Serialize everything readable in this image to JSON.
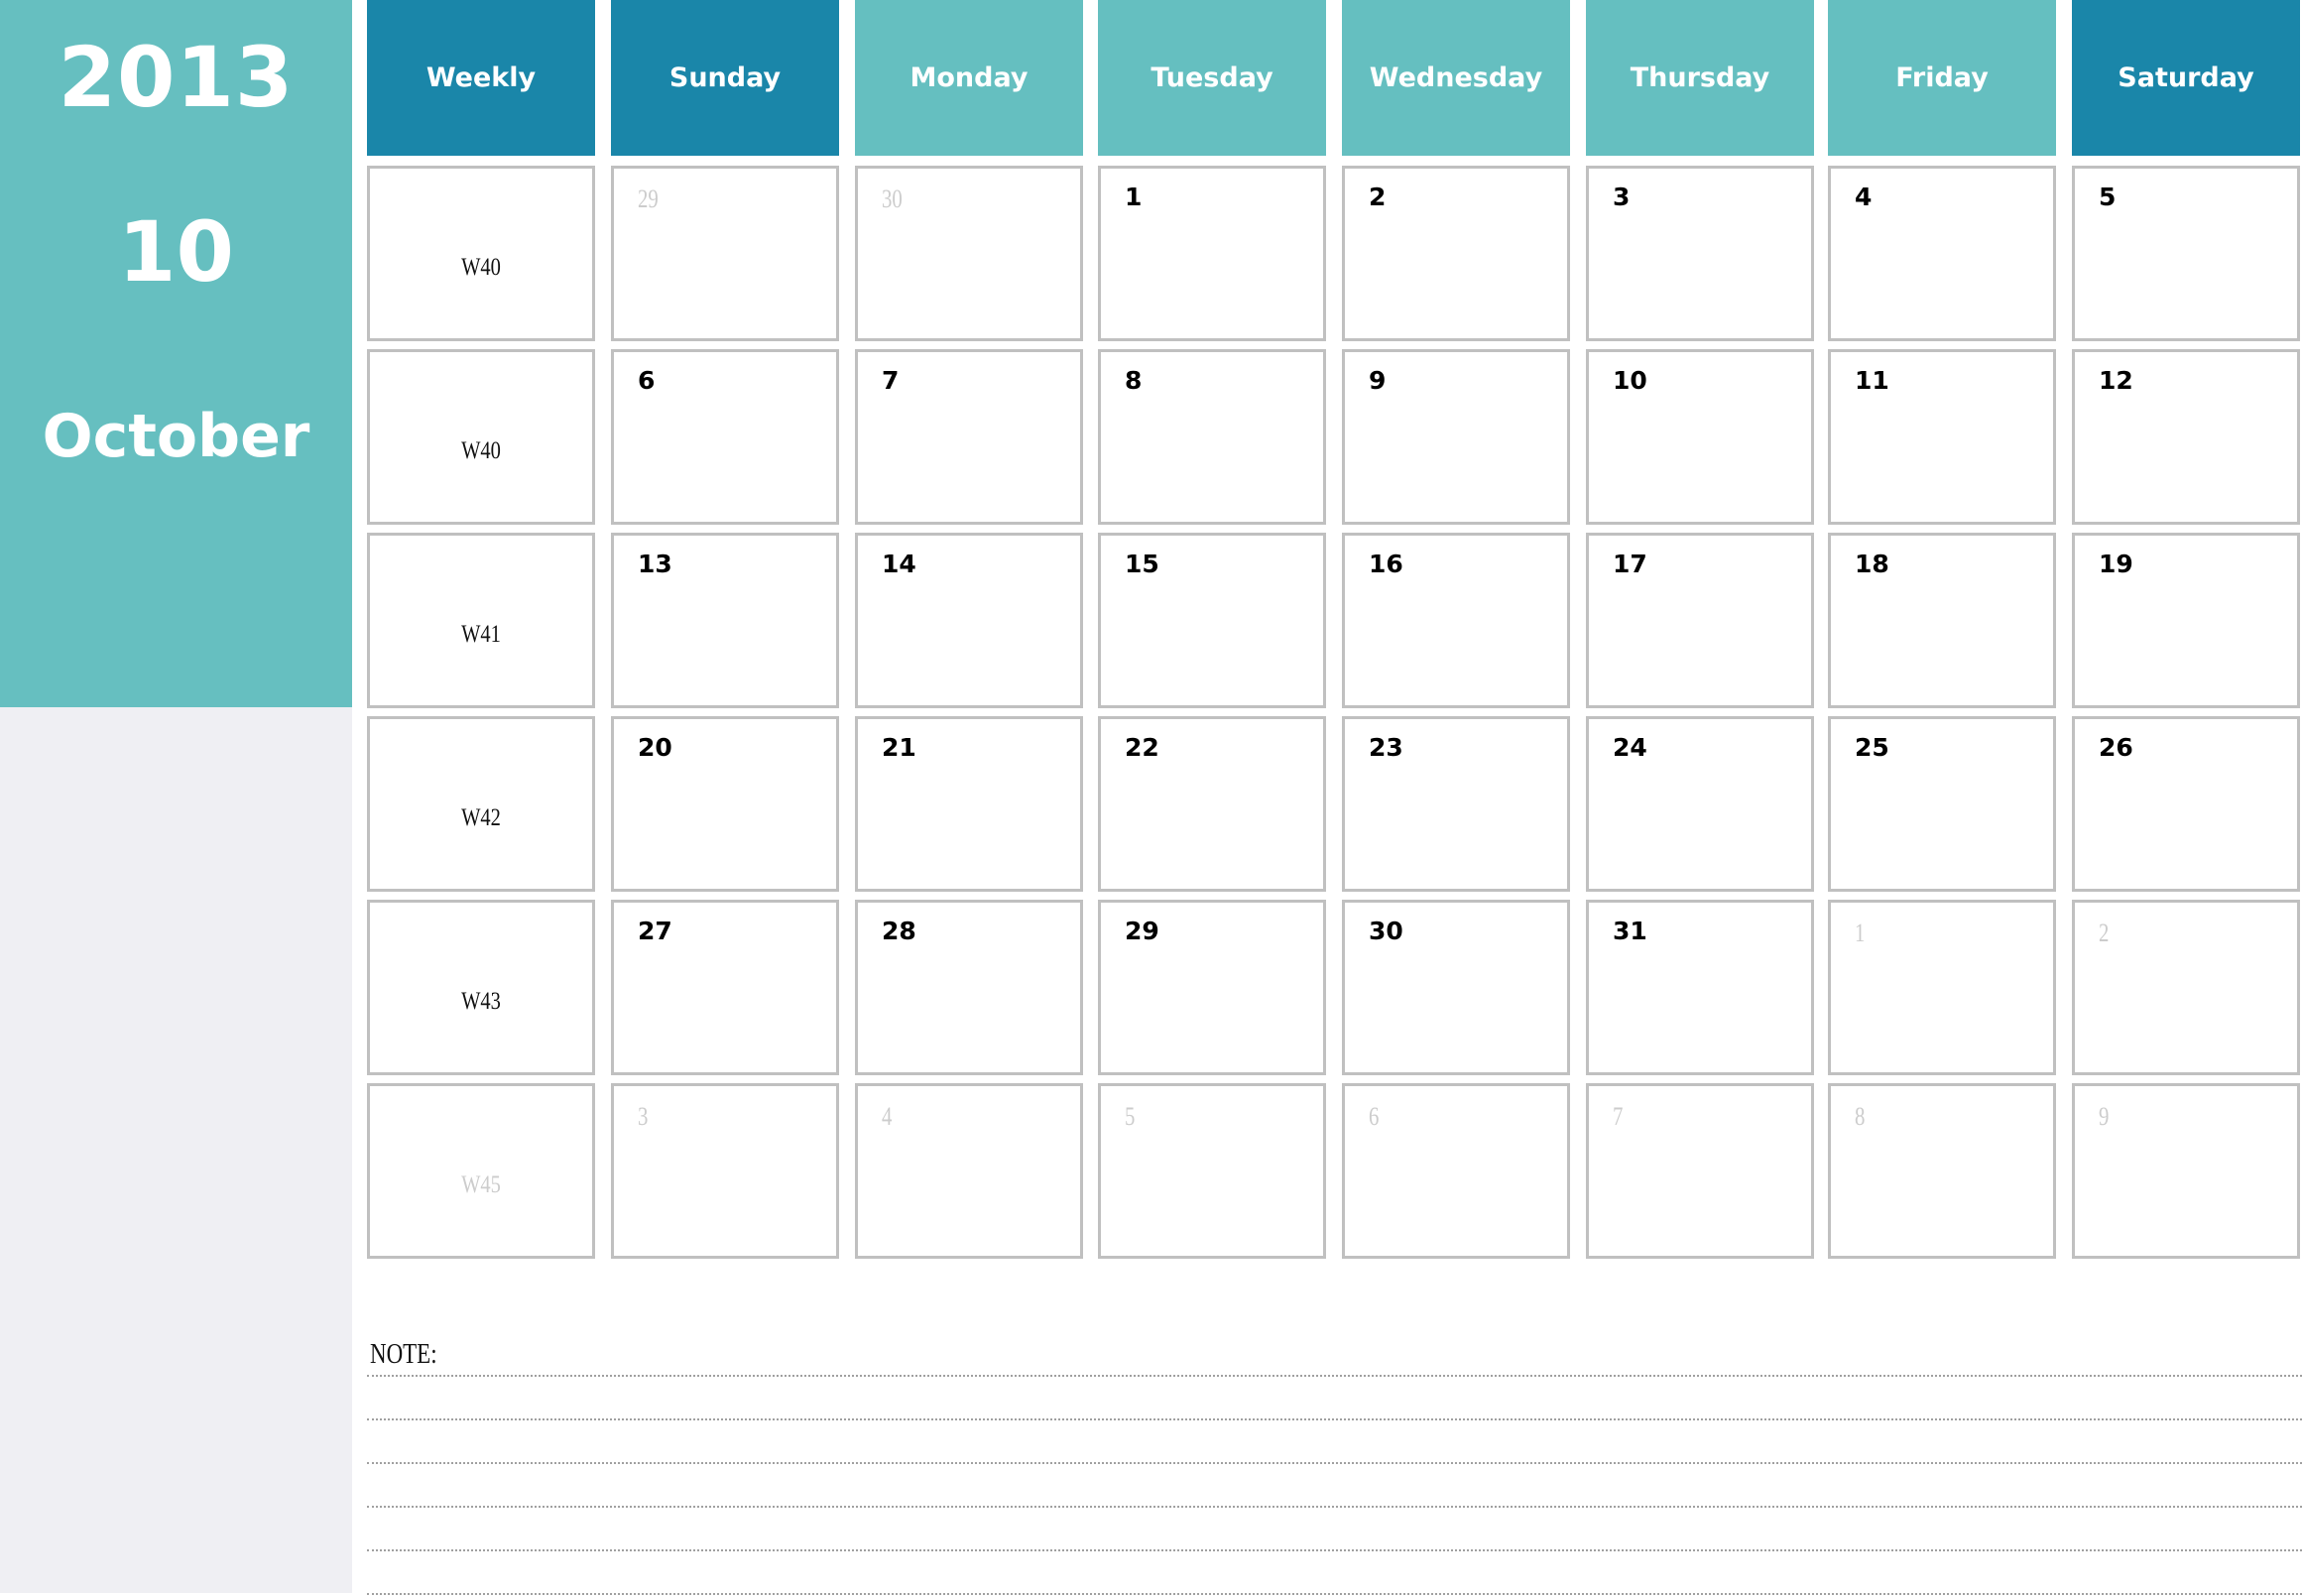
{
  "sidebar": {
    "year": "2013",
    "month_number": "10",
    "month_name": "October"
  },
  "colors": {
    "accent_dark": "#1a86a9",
    "accent_light": "#65bfc0",
    "sidebar_bottom": "#efeff3",
    "cell_border": "#c0c0c0",
    "other_month_text": "#cccccc"
  },
  "header": {
    "columns": [
      {
        "label": "Weekly",
        "style": "dark"
      },
      {
        "label": "Sunday",
        "style": "dark"
      },
      {
        "label": "Monday",
        "style": "light"
      },
      {
        "label": "Tuesday",
        "style": "light"
      },
      {
        "label": "Wednesday",
        "style": "light"
      },
      {
        "label": "Thursday",
        "style": "light"
      },
      {
        "label": "Friday",
        "style": "light"
      },
      {
        "label": "Saturday",
        "style": "dark"
      }
    ]
  },
  "weeks": [
    {
      "week": "W40",
      "week_other": false,
      "days": [
        {
          "d": "29",
          "other": true
        },
        {
          "d": "30",
          "other": true
        },
        {
          "d": "1",
          "other": false
        },
        {
          "d": "2",
          "other": false
        },
        {
          "d": "3",
          "other": false
        },
        {
          "d": "4",
          "other": false
        },
        {
          "d": "5",
          "other": false
        }
      ]
    },
    {
      "week": "W40",
      "week_other": false,
      "days": [
        {
          "d": "6",
          "other": false
        },
        {
          "d": "7",
          "other": false
        },
        {
          "d": "8",
          "other": false
        },
        {
          "d": "9",
          "other": false
        },
        {
          "d": "10",
          "other": false
        },
        {
          "d": "11",
          "other": false
        },
        {
          "d": "12",
          "other": false
        }
      ]
    },
    {
      "week": "W41",
      "week_other": false,
      "days": [
        {
          "d": "13",
          "other": false
        },
        {
          "d": "14",
          "other": false
        },
        {
          "d": "15",
          "other": false
        },
        {
          "d": "16",
          "other": false
        },
        {
          "d": "17",
          "other": false
        },
        {
          "d": "18",
          "other": false
        },
        {
          "d": "19",
          "other": false
        }
      ]
    },
    {
      "week": "W42",
      "week_other": false,
      "days": [
        {
          "d": "20",
          "other": false
        },
        {
          "d": "21",
          "other": false
        },
        {
          "d": "22",
          "other": false
        },
        {
          "d": "23",
          "other": false
        },
        {
          "d": "24",
          "other": false
        },
        {
          "d": "25",
          "other": false
        },
        {
          "d": "26",
          "other": false
        }
      ]
    },
    {
      "week": "W43",
      "week_other": false,
      "days": [
        {
          "d": "27",
          "other": false
        },
        {
          "d": "28",
          "other": false
        },
        {
          "d": "29",
          "other": false
        },
        {
          "d": "30",
          "other": false
        },
        {
          "d": "31",
          "other": false
        },
        {
          "d": "1",
          "other": true
        },
        {
          "d": "2",
          "other": true
        }
      ]
    },
    {
      "week": "W45",
      "week_other": true,
      "days": [
        {
          "d": "3",
          "other": true
        },
        {
          "d": "4",
          "other": true
        },
        {
          "d": "5",
          "other": true
        },
        {
          "d": "6",
          "other": true
        },
        {
          "d": "7",
          "other": true
        },
        {
          "d": "8",
          "other": true
        },
        {
          "d": "9",
          "other": true
        }
      ]
    }
  ],
  "notes": {
    "label": "NOTE:",
    "line_count": 6
  }
}
